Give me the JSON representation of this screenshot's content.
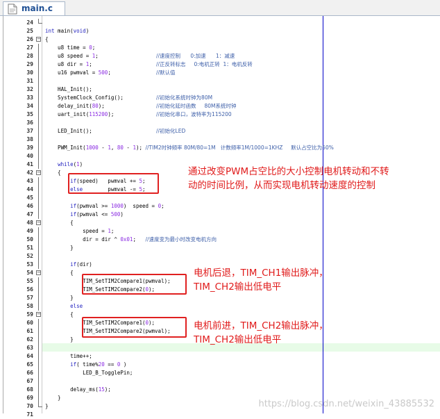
{
  "tab": {
    "filename": "main.c",
    "icon": "c-file-icon"
  },
  "annotations": {
    "pwm": [
      "通过改变PWM占空比的大小控制电机转动和不转",
      "动的时间比例，从而实现电机转动速度的控制"
    ],
    "backward": [
      "电机后退，TIM_CH1输出脉冲，",
      "TIM_CH2输出低电平"
    ],
    "forward": [
      "电机前进，TIM_CH2输出脉冲，",
      "TIM_CH2输出低电平"
    ]
  },
  "watermark": "https://blog.csdn.net/weixin_43885532",
  "lines": [
    {
      "n": "24",
      "t": ""
    },
    {
      "n": "25",
      "t": "int main(void)"
    },
    {
      "n": "26",
      "t": "{"
    },
    {
      "n": "27",
      "t": "    u8 time = 0;"
    },
    {
      "n": "28",
      "t": "    u8 speed = 1;",
      "c": "//速度控制      0:加速      1：减速"
    },
    {
      "n": "29",
      "t": "    u8 dir = 1;",
      "c": "//正反转标志     0:电机正转  1：电机反转"
    },
    {
      "n": "30",
      "t": "    u16 pwmval = 500;",
      "c": "//默认值"
    },
    {
      "n": "31",
      "t": ""
    },
    {
      "n": "32",
      "t": "    HAL_Init();"
    },
    {
      "n": "33",
      "t": "    SystemClock_Config();",
      "c": "//初始化系统时钟为80M"
    },
    {
      "n": "34",
      "t": "    delay_init(80);",
      "c": "//初始化延时函数     80M系统时钟"
    },
    {
      "n": "35",
      "t": "    uart_init(115200);",
      "c": "//初始化串口，波特率为115200"
    },
    {
      "n": "36",
      "t": ""
    },
    {
      "n": "37",
      "t": "    LED_Init();",
      "c": "//初始化LED"
    },
    {
      "n": "38",
      "t": ""
    },
    {
      "n": "39",
      "t": "    PWM_Init(1000 - 1, 80 - 1); //TIM2时钟频率 80M/80=1M   计数频率1M/1000=1KHZ     默认占空比为50%"
    },
    {
      "n": "40",
      "t": ""
    },
    {
      "n": "41",
      "t": "    while(1)"
    },
    {
      "n": "42",
      "t": "    {"
    },
    {
      "n": "43",
      "t": "        if(speed)   pwmval += 5;"
    },
    {
      "n": "44",
      "t": "        else        pwmval -= 5;"
    },
    {
      "n": "45",
      "t": ""
    },
    {
      "n": "46",
      "t": "        if(pwmval >= 1000)  speed = 0;"
    },
    {
      "n": "47",
      "t": "        if(pwmval <= 500)"
    },
    {
      "n": "48",
      "t": "        {"
    },
    {
      "n": "49",
      "t": "            speed = 1;"
    },
    {
      "n": "50",
      "t": "            dir = dir ^ 0x01;   //速度变为最小时改变电机方向"
    },
    {
      "n": "51",
      "t": "        }"
    },
    {
      "n": "52",
      "t": ""
    },
    {
      "n": "53",
      "t": "        if(dir)"
    },
    {
      "n": "54",
      "t": "        {"
    },
    {
      "n": "55",
      "t": "            TIM_SetTIM2Compare1(pwmval);"
    },
    {
      "n": "56",
      "t": "            TIM_SetTIM2Compare2(0);"
    },
    {
      "n": "57",
      "t": "        }"
    },
    {
      "n": "58",
      "t": "        else"
    },
    {
      "n": "59",
      "t": "        {"
    },
    {
      "n": "60",
      "t": "            TIM_SetTIM2Compare1(0);"
    },
    {
      "n": "61",
      "t": "            TIM_SetTIM2Compare2(pwmval);"
    },
    {
      "n": "62",
      "t": "        }"
    },
    {
      "n": "63",
      "t": ""
    },
    {
      "n": "64",
      "t": "        time++;"
    },
    {
      "n": "65",
      "t": "        if( time%20 == 0 )"
    },
    {
      "n": "66",
      "t": "            LED_B_TogglePin;"
    },
    {
      "n": "67",
      "t": ""
    },
    {
      "n": "68",
      "t": "        delay_ms(15);"
    },
    {
      "n": "69",
      "t": "    }"
    },
    {
      "n": "70",
      "t": "}"
    },
    {
      "n": "71",
      "t": ""
    }
  ]
}
